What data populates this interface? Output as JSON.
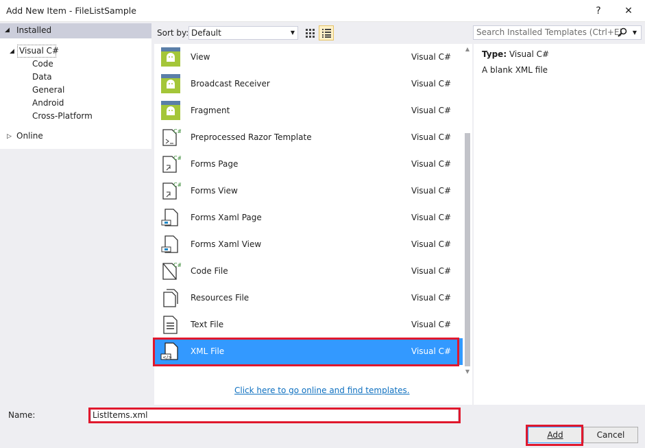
{
  "window": {
    "title": "Add New Item - FileListSample",
    "help_glyph": "?",
    "close_glyph": "✕"
  },
  "tree": {
    "installed": {
      "label": "Installed",
      "arrow": "◢"
    },
    "visual_csharp": {
      "label": "Visual C#",
      "arrow": "◢"
    },
    "children": [
      "Code",
      "Data",
      "General",
      "Android",
      "Cross-Platform"
    ],
    "online": {
      "label": "Online",
      "arrow": "▷"
    }
  },
  "toolbar": {
    "sort_label": "Sort by:",
    "sort_value": "Default",
    "search_placeholder": "Search Installed Templates (Ctrl+E)"
  },
  "templates": [
    {
      "name": "View",
      "lang": "Visual C#",
      "icon": "android-icon"
    },
    {
      "name": "Broadcast Receiver",
      "lang": "Visual C#",
      "icon": "android-icon"
    },
    {
      "name": "Fragment",
      "lang": "Visual C#",
      "icon": "android-icon"
    },
    {
      "name": "Preprocessed Razor Template",
      "lang": "Visual C#",
      "icon": "razor-template-icon"
    },
    {
      "name": "Forms Page",
      "lang": "Visual C#",
      "icon": "forms-page-icon"
    },
    {
      "name": "Forms View",
      "lang": "Visual C#",
      "icon": "forms-view-icon"
    },
    {
      "name": "Forms Xaml Page",
      "lang": "Visual C#",
      "icon": "xaml-page-icon"
    },
    {
      "name": "Forms Xaml View",
      "lang": "Visual C#",
      "icon": "xaml-view-icon"
    },
    {
      "name": "Code File",
      "lang": "Visual C#",
      "icon": "code-file-icon"
    },
    {
      "name": "Resources File",
      "lang": "Visual C#",
      "icon": "resources-file-icon"
    },
    {
      "name": "Text File",
      "lang": "Visual C#",
      "icon": "text-file-icon"
    },
    {
      "name": "XML File",
      "lang": "Visual C#",
      "icon": "xml-file-icon",
      "selected": true
    }
  ],
  "online_link": "Click here to go online and find templates.",
  "details": {
    "type_label": "Type:",
    "type_value": "Visual C#",
    "description": "A blank XML file"
  },
  "form": {
    "name_label": "Name:",
    "name_value": "ListItems.xml"
  },
  "buttons": {
    "add": "Add",
    "cancel": "Cancel"
  },
  "colors": {
    "selection": "#3399ff",
    "highlight": "#e0182d",
    "link": "#0e70c0"
  }
}
